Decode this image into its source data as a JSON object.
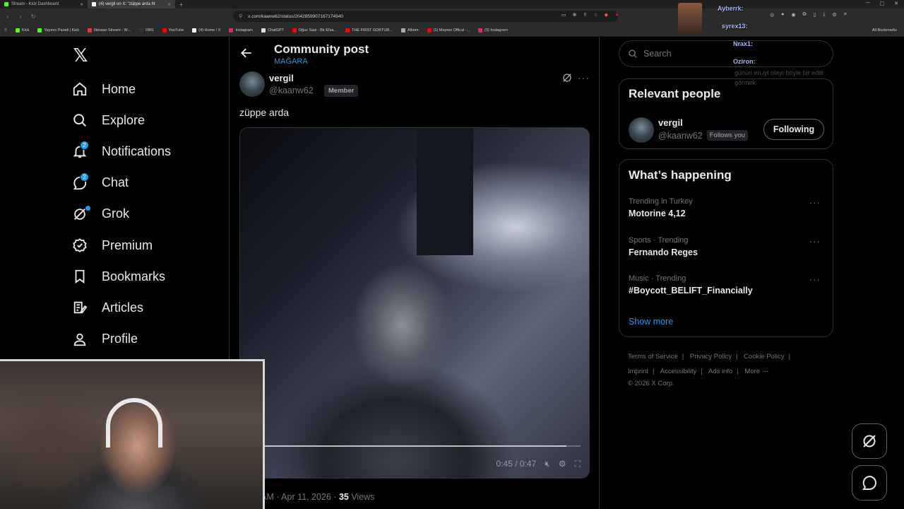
{
  "browser": {
    "tabs": [
      {
        "title": "Stream - Kick Dashboard",
        "icon": "kick-icon",
        "active": false
      },
      {
        "title": "(4) vergil on X: \"züppe arda ht",
        "icon": "x-icon",
        "active": true
      }
    ],
    "url": "x.com/kaanw62/status/2042859907167174940",
    "bookmarks": [
      "Kick",
      "Yayıncı Paneli | Kick",
      "ilkinsan Stream - W...",
      "OBS",
      "YouTube",
      "(4) Home / X",
      "Instagram",
      "ChatGPT",
      "Oğuz Sasi - Bir Efsa...",
      "THE FIRST GOKTUR...",
      "Albüm",
      "(1) Meprez Offical -...",
      "(9) Instagram"
    ],
    "all_bookmarks": "All Bookmarks"
  },
  "nav": {
    "items": [
      {
        "label": "Home",
        "icon": "home-icon"
      },
      {
        "label": "Explore",
        "icon": "search-icon"
      },
      {
        "label": "Notifications",
        "icon": "bell-icon",
        "badge": "2"
      },
      {
        "label": "Chat",
        "icon": "chat-icon",
        "badge": "2"
      },
      {
        "label": "Grok",
        "icon": "grok-icon",
        "dot": true
      },
      {
        "label": "Premium",
        "icon": "premium-icon"
      },
      {
        "label": "Bookmarks",
        "icon": "bookmark-icon"
      },
      {
        "label": "Articles",
        "icon": "articles-icon"
      },
      {
        "label": "Profile",
        "icon": "profile-icon"
      }
    ]
  },
  "post": {
    "header_title": "Community post",
    "community": "MAĞARA",
    "author_name": "vergil",
    "author_handle": "@kaanw62",
    "member_label": "Member",
    "text": "züppe arda",
    "video_time": "0:45 / 0:47",
    "video_progress": 0.957,
    "meta_time": "AM · Apr 11, 2026 · ",
    "views_count": "35",
    "views_label": " Views"
  },
  "sidebar": {
    "search_placeholder": "Search",
    "relevant_title": "Relevant people",
    "person_name": "vergil",
    "person_handle": "@kaanw62",
    "follows_you": "Follows you",
    "following_label": "Following",
    "happening_title": "What’s happening",
    "trends": [
      {
        "category": "Trending in Turkey",
        "name": "Motorine 4,12"
      },
      {
        "category": "Sports · Trending",
        "name": "Fernando Reges"
      },
      {
        "category": "Music · Trending",
        "name": "#Boycott_BELIFT_Financially"
      }
    ],
    "show_more": "Show more",
    "footer_links": [
      "Terms of Service",
      "Privacy Policy",
      "Cookie Policy",
      "Imprint",
      "Accessibility",
      "Ads info",
      "More ···"
    ],
    "copyright": "© 2026 X Corp."
  },
  "stream_chat": {
    "users": [
      "Ayberrk:",
      "syrex13:",
      "Nrax1:",
      "Oziron:"
    ],
    "faint_message": "günün en iyi olayı böyle bir editi",
    "faint_message2": "görmek"
  },
  "colors": {
    "accent": "#1d9bf0",
    "background": "#000000",
    "border": "#2f3336",
    "muted": "#71767b"
  }
}
